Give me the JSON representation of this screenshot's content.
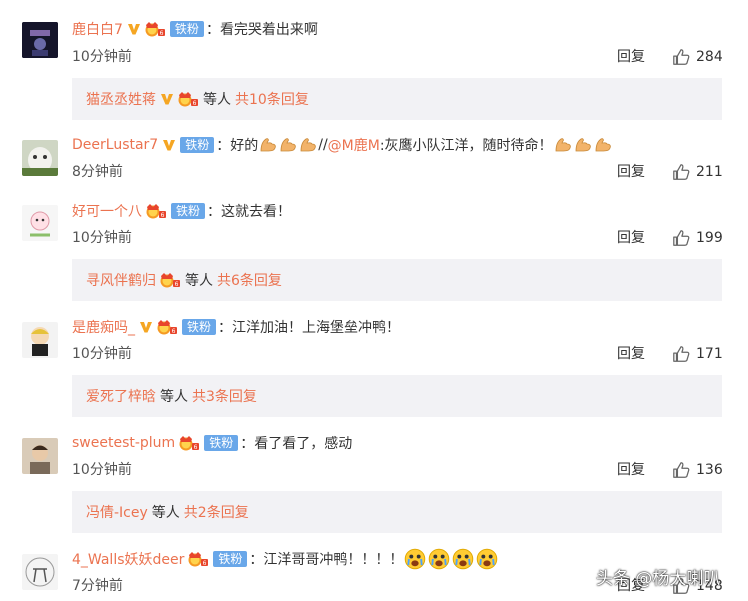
{
  "comments": [
    {
      "username": "鹿白白7",
      "fan_label": "铁粉",
      "text": "看完哭着出来啊",
      "time": "10分钟前",
      "reply_label": "回复",
      "likes": "284",
      "sub": {
        "who": "猫丞丞姓蒋",
        "etc": "等人",
        "count": "共10条回复"
      }
    },
    {
      "username": "DeerLustar7",
      "fan_label": "铁粉",
      "text_before": "好的",
      "text_slash": "//",
      "mention": "@M鹿M",
      "text_after": ":灰鹰小队江洋，随时待命！",
      "time": "8分钟前",
      "reply_label": "回复",
      "likes": "211"
    },
    {
      "username": "好可一个八",
      "fan_label": "铁粉",
      "text": "这就去看！",
      "time": "10分钟前",
      "reply_label": "回复",
      "likes": "199",
      "sub": {
        "who": "寻风伴鹤归",
        "etc": "等人",
        "count": "共6条回复"
      }
    },
    {
      "username": "是鹿痴吗_",
      "fan_label": "铁粉",
      "text": "江洋加油！上海堡垒冲鸭！",
      "time": "10分钟前",
      "reply_label": "回复",
      "likes": "171",
      "sub": {
        "who": "爱死了梓晗",
        "etc": "等人",
        "count": "共3条回复"
      }
    },
    {
      "username": "sweetest-plum",
      "fan_label": "铁粉",
      "text": "看了看了，感动",
      "time": "10分钟前",
      "reply_label": "回复",
      "likes": "136",
      "sub": {
        "who": "冯倩-Icey",
        "etc": "等人",
        "count": "共2条回复"
      }
    },
    {
      "username": "4_Walls妖妖deer",
      "fan_label": "铁粉",
      "text": "江洋哥哥冲鸭！！！！",
      "time": "7分钟前",
      "reply_label": "回复",
      "likes": "148"
    }
  ],
  "watermark": "头条 @杨大喇叭",
  "colors": {
    "username": "#eb7350",
    "fan_badge": "#69a7e9",
    "subbox_bg": "#f2f2f5",
    "v_badge": "#f5a623"
  },
  "icons": [
    "vip-v-icon",
    "crown-member-icon",
    "thumbs-up-icon",
    "strong-arm-emoji",
    "crying-face-emoji"
  ]
}
